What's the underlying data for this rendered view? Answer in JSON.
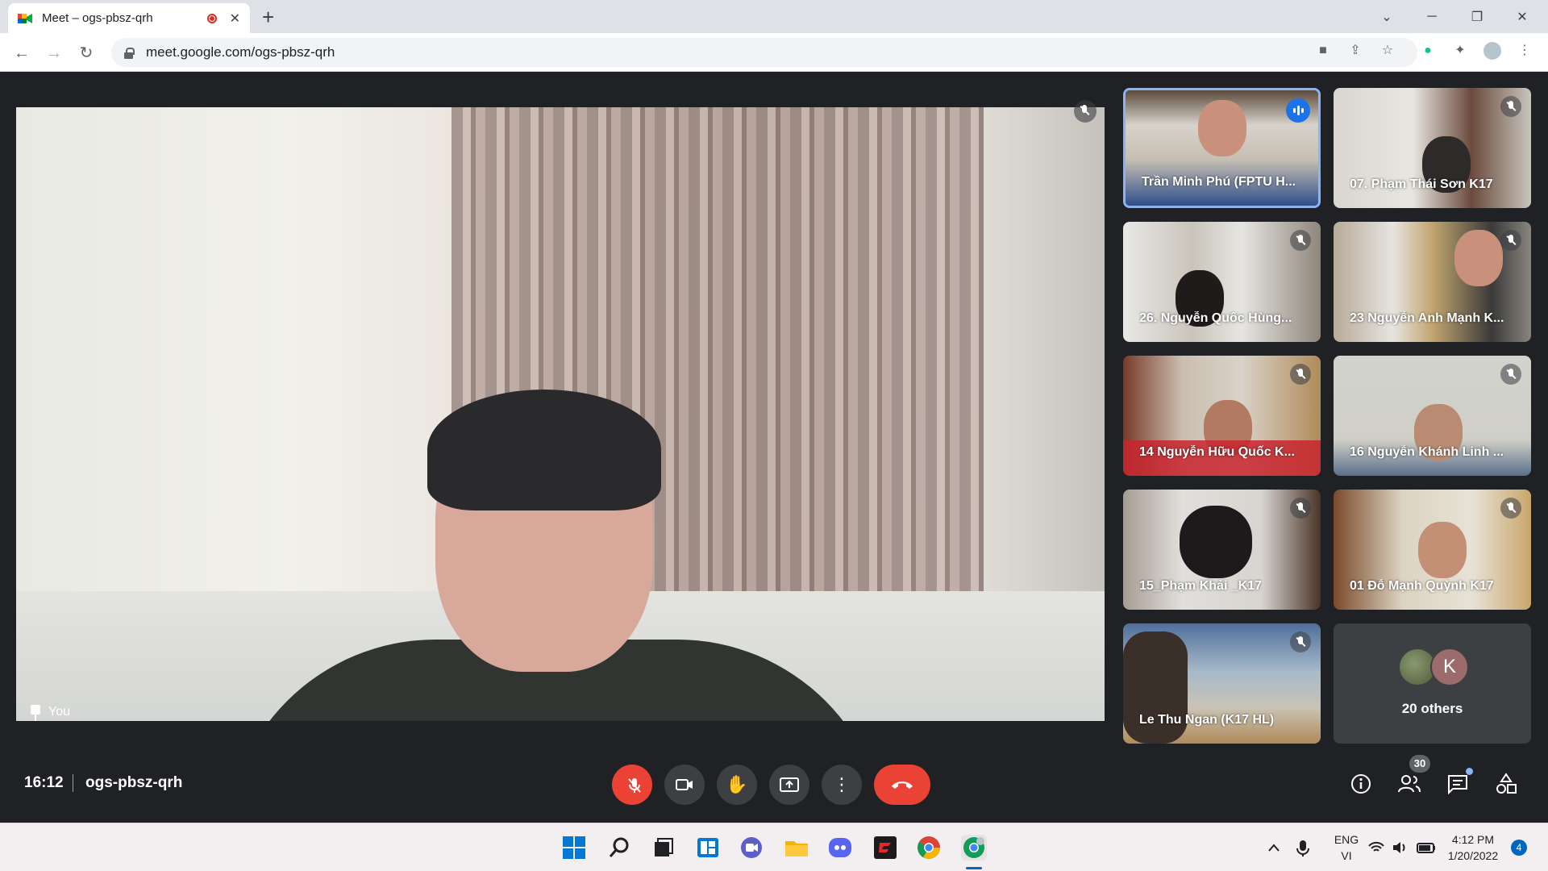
{
  "browser": {
    "tab_title": "Meet – ogs-pbsz-qrh",
    "new_tab": "+",
    "url": "meet.google.com/ogs-pbsz-qrh"
  },
  "meeting": {
    "self_label": "You",
    "time": "16:12",
    "code": "ogs-pbsz-qrh",
    "participant_count": "30",
    "others_label": "20 others",
    "others_avatar_letter": "K"
  },
  "participants": [
    {
      "name": "Trần Minh Phú (FPTU H...",
      "speaking": true
    },
    {
      "name": "07. Phạm Thái Sơn K17",
      "speaking": false
    },
    {
      "name": "26. Nguyễn Quốc Hùng...",
      "speaking": false
    },
    {
      "name": "23 Nguyễn Anh Mạnh K...",
      "speaking": false
    },
    {
      "name": "14 Nguyễn Hữu Quốc K...",
      "speaking": false
    },
    {
      "name": "16 Nguyễn Khánh Linh ...",
      "speaking": false
    },
    {
      "name": "15_Phạm Khải _K17",
      "speaking": false
    },
    {
      "name": "01 Đỗ Mạnh Quỳnh K17",
      "speaking": false
    },
    {
      "name": "Le Thu Ngan (K17 HL)",
      "speaking": false
    }
  ],
  "taskbar": {
    "lang_top": "ENG",
    "lang_bottom": "VI",
    "clock_time": "4:12 PM",
    "clock_date": "1/20/2022",
    "notifications": "4"
  },
  "colors": {
    "meet_bg": "#202124",
    "danger": "#ea4335",
    "active_border": "#8ab4f8",
    "speaking": "#1a73e8"
  }
}
